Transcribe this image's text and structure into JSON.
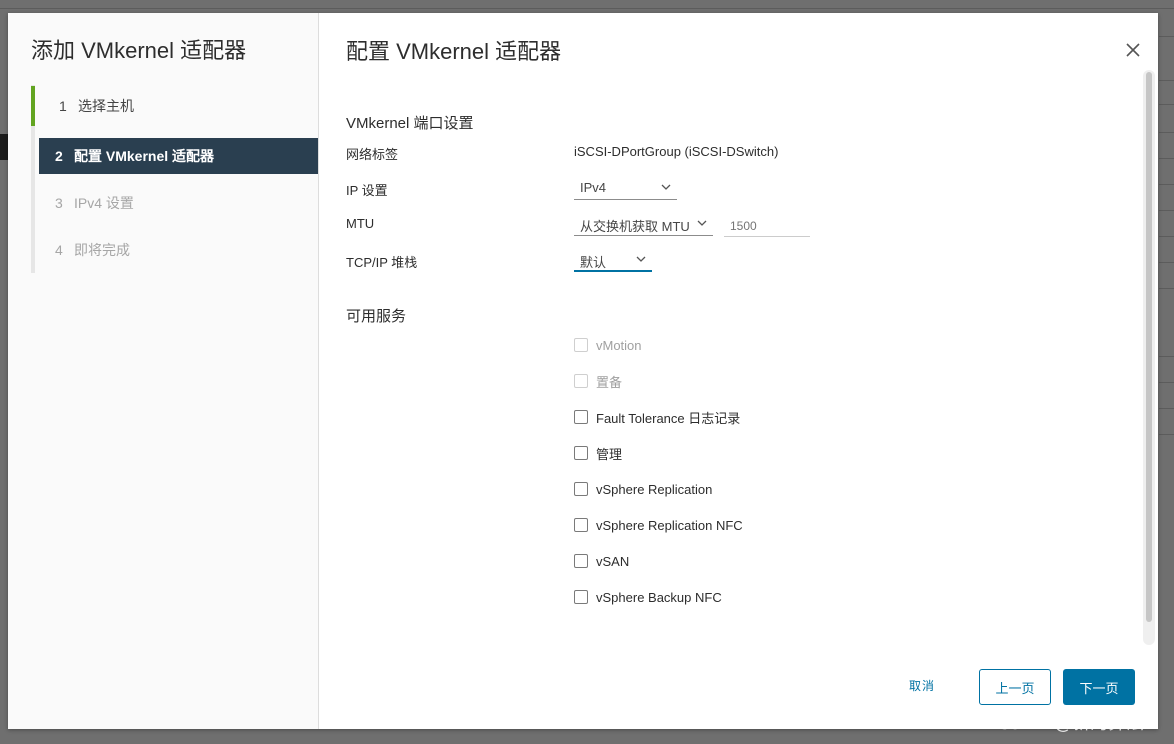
{
  "wizard": {
    "title": "添加 VMkernel 适配器",
    "steps": [
      {
        "num": "1",
        "label": "选择主机"
      },
      {
        "num": "2",
        "label": "配置 VMkernel 适配器"
      },
      {
        "num": "3",
        "label": "IPv4 设置"
      },
      {
        "num": "4",
        "label": "即将完成"
      }
    ]
  },
  "content": {
    "title": "配置 VMkernel 适配器",
    "port_settings": {
      "section_title": "VMkernel 端口设置",
      "network_label": {
        "label": "网络标签",
        "value": "iSCSI-DPortGroup (iSCSI-DSwitch)"
      },
      "ip_settings": {
        "label": "IP 设置",
        "selected": "IPv4"
      },
      "mtu": {
        "label": "MTU",
        "selected": "从交换机获取 MTU",
        "placeholder": "1500"
      },
      "tcpip_stack": {
        "label": "TCP/IP 堆栈",
        "selected": "默认"
      }
    },
    "services": {
      "section_title": "可用服务",
      "items": [
        {
          "label": "vMotion",
          "enabled": false,
          "checked": false
        },
        {
          "label": "置备",
          "enabled": false,
          "checked": false
        },
        {
          "label": "Fault Tolerance 日志记录",
          "enabled": true,
          "checked": false
        },
        {
          "label": "管理",
          "enabled": true,
          "checked": false
        },
        {
          "label": "vSphere Replication",
          "enabled": true,
          "checked": false
        },
        {
          "label": "vSphere Replication NFC",
          "enabled": true,
          "checked": false
        },
        {
          "label": "vSAN",
          "enabled": true,
          "checked": false
        },
        {
          "label": "vSphere Backup NFC",
          "enabled": true,
          "checked": false
        }
      ]
    }
  },
  "footer": {
    "cancel": "取消",
    "back": "上一页",
    "next": "下一页"
  },
  "watermark": "CSDN @新的算法",
  "icons": {
    "close": "close-icon",
    "chevron": "chevron-down-icon"
  },
  "colors": {
    "accent": "#0072a3",
    "active_step_bg": "#2a3f50",
    "step_complete": "#62a420"
  }
}
